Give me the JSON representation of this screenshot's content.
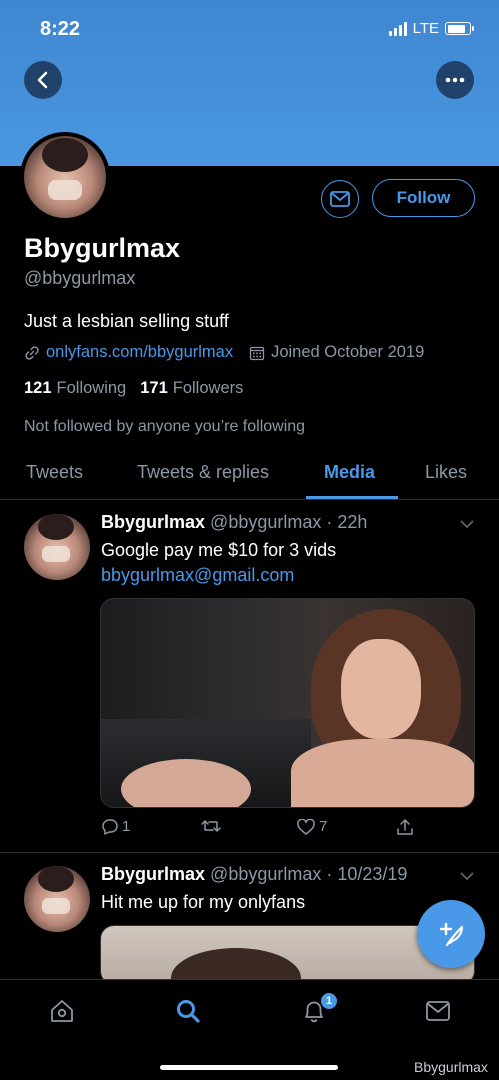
{
  "status_bar": {
    "time": "8:22",
    "network": "LTE",
    "battery_level": 0.85
  },
  "header": {
    "back_icon": "chevron-left-icon",
    "more_icon": "ellipsis-icon"
  },
  "profile": {
    "display_name": "Bbygurlmax",
    "handle": "@bbygurlmax",
    "bio": "Just a lesbian selling stuff",
    "link": "onlyfans.com/bbygurlmax",
    "joined": "Joined October 2019",
    "following_count": "121",
    "following_label": "Following",
    "followers_count": "171",
    "followers_label": "Followers",
    "not_followed_text": "Not followed by anyone you’re following",
    "follow_label": "Follow"
  },
  "tabs": [
    {
      "label": "Tweets"
    },
    {
      "label": "Tweets & replies"
    },
    {
      "label": "Media",
      "active": true
    },
    {
      "label": "Likes"
    }
  ],
  "tweets": [
    {
      "name": "Bbygurlmax",
      "handle": "@bbygurlmax",
      "time": "22h",
      "text": "Google pay me $10 for 3 vids",
      "link": "bbygurlmax@gmail.com",
      "replies": "1",
      "retweets": "",
      "likes": "7"
    },
    {
      "name": "Bbygurlmax",
      "handle": "@bbygurlmax",
      "time": "10/23/19",
      "text": "Hit me up for my onlyfans"
    }
  ],
  "bottom_nav": {
    "notification_badge": "1"
  },
  "watermark": "Bbygurlmax",
  "colors": {
    "accent": "#4a99e9",
    "banner": "#4a97e0",
    "background": "#000000",
    "secondary_text": "#8b98a5"
  }
}
